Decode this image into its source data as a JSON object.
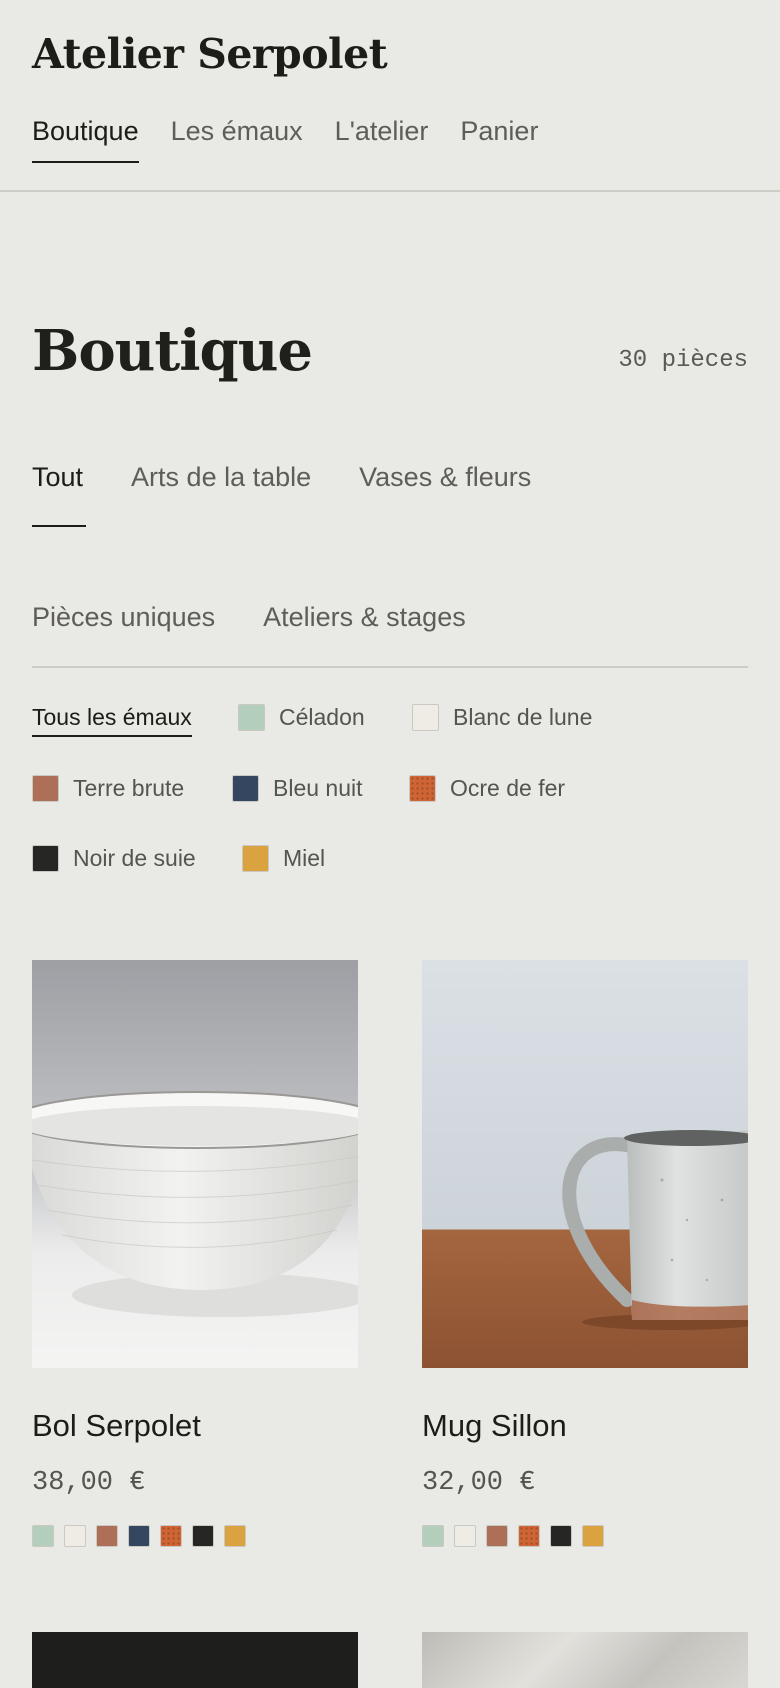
{
  "brand": "Atelier Serpolet",
  "nav": [
    "Boutique",
    "Les émaux",
    "L'atelier",
    "Panier"
  ],
  "page": {
    "title": "Boutique",
    "count": "30 pièces"
  },
  "categories": [
    "Tout",
    "Arts de la table",
    "Vases & fleurs",
    "Pièces uniques",
    "Ateliers & stages"
  ],
  "glazes": {
    "all_label": "Tous les émaux",
    "items": [
      {
        "label": "Céladon",
        "color": "#b3cfbc"
      },
      {
        "label": "Blanc de lune",
        "color": "#efece6"
      },
      {
        "label": "Terre brute",
        "color": "#ad6f57"
      },
      {
        "label": "Bleu nuit",
        "color": "#354661"
      },
      {
        "label": "Ocre de fer",
        "color": "#cf6435"
      },
      {
        "label": "Noir de suie",
        "color": "#262624"
      },
      {
        "label": "Miel",
        "color": "#dba340"
      }
    ]
  },
  "products": [
    {
      "name": "Bol Serpolet",
      "price": "38,00 €",
      "swatch_colors": [
        "#b3cfbc",
        "#efece6",
        "#ad6f57",
        "#354661",
        "#cf6435",
        "#262624",
        "#dba340"
      ]
    },
    {
      "name": "Mug Sillon",
      "price": "32,00 €",
      "swatch_colors": [
        "#b3cfbc",
        "#efece6",
        "#ad6f57",
        "#cf6435",
        "#262624",
        "#dba340"
      ]
    }
  ],
  "colors": {
    "background": "#e9e9e5",
    "text": "#1f1f1c",
    "muted": "#5e5d58",
    "divider": "#cdcdc8"
  }
}
